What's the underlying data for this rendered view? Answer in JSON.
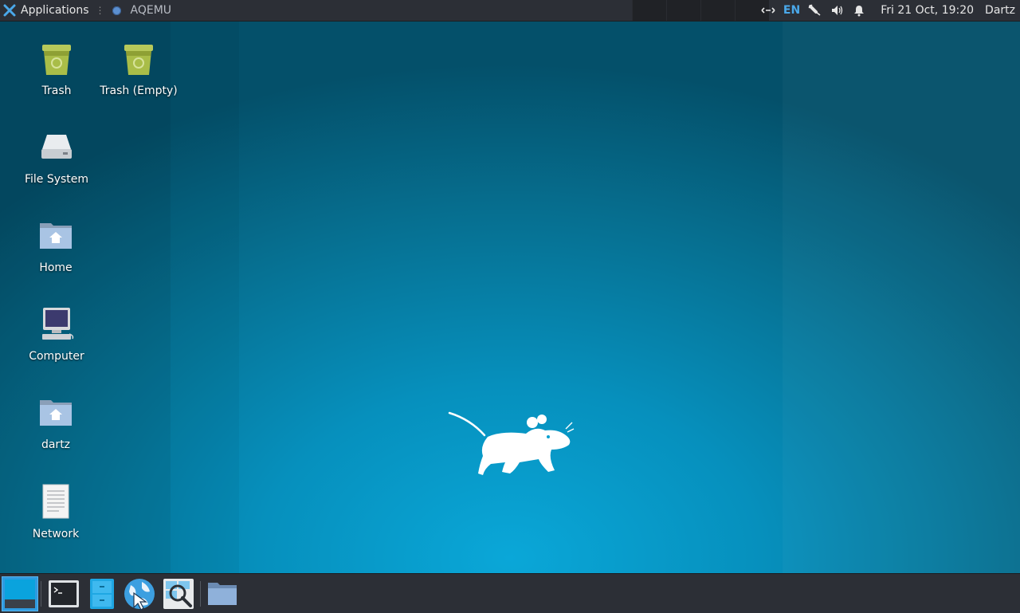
{
  "top_panel": {
    "applications_label": "Applications",
    "task_label": "AQEMU",
    "language": "EN",
    "clock": "Fri 21 Oct, 19:20",
    "user": "Dartz"
  },
  "desktop_icons": [
    {
      "label": "Trash",
      "icon": "trash-full-icon"
    },
    {
      "label": "Trash (Empty)",
      "icon": "trash-empty-icon"
    },
    {
      "label": "File System",
      "icon": "drive-icon"
    },
    {
      "label": "Home",
      "icon": "home-folder-icon"
    },
    {
      "label": "Computer",
      "icon": "computer-icon"
    },
    {
      "label": "dartz",
      "icon": "home-folder-icon"
    },
    {
      "label": "Network",
      "icon": "document-icon"
    }
  ],
  "bottom_panel": {
    "items": [
      "show-desktop-icon",
      "terminal-icon",
      "file-manager-icon",
      "web-browser-icon",
      "app-finder-icon",
      "folder-icon"
    ]
  },
  "colors": {
    "accent": "#2f9be0",
    "panel_bg": "#2c2f36",
    "desktop_bg": "#0690bd"
  }
}
